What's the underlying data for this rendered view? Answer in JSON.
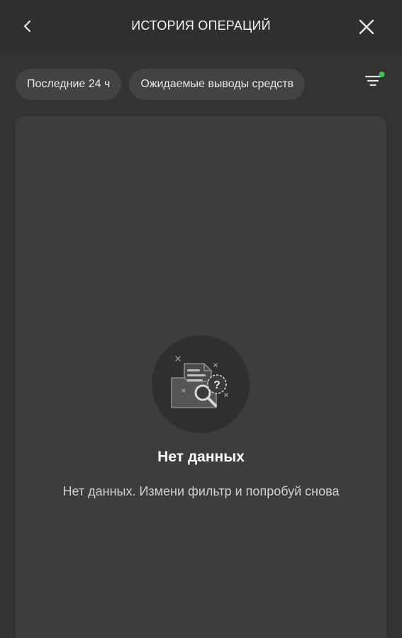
{
  "header": {
    "title": "ИСТОРИЯ ОПЕРАЦИЙ",
    "back_icon": "chevron-left-icon",
    "close_icon": "close-icon"
  },
  "filters": {
    "chips": [
      {
        "label": "Последние 24 ч"
      },
      {
        "label": "Ожидаемые выводы средств"
      }
    ],
    "filter_icon": "filter-icon",
    "filter_active_dot_color": "#3cc74a"
  },
  "empty_state": {
    "icon": "empty-search-document-icon",
    "title": "Нет данных",
    "message": "Нет данных. Измени фильтр и попробуй снова"
  },
  "colors": {
    "background": "#333333",
    "header": "#2f2f2f",
    "card": "#3d3d3d",
    "chip": "#434343",
    "accent": "#3cc74a"
  }
}
